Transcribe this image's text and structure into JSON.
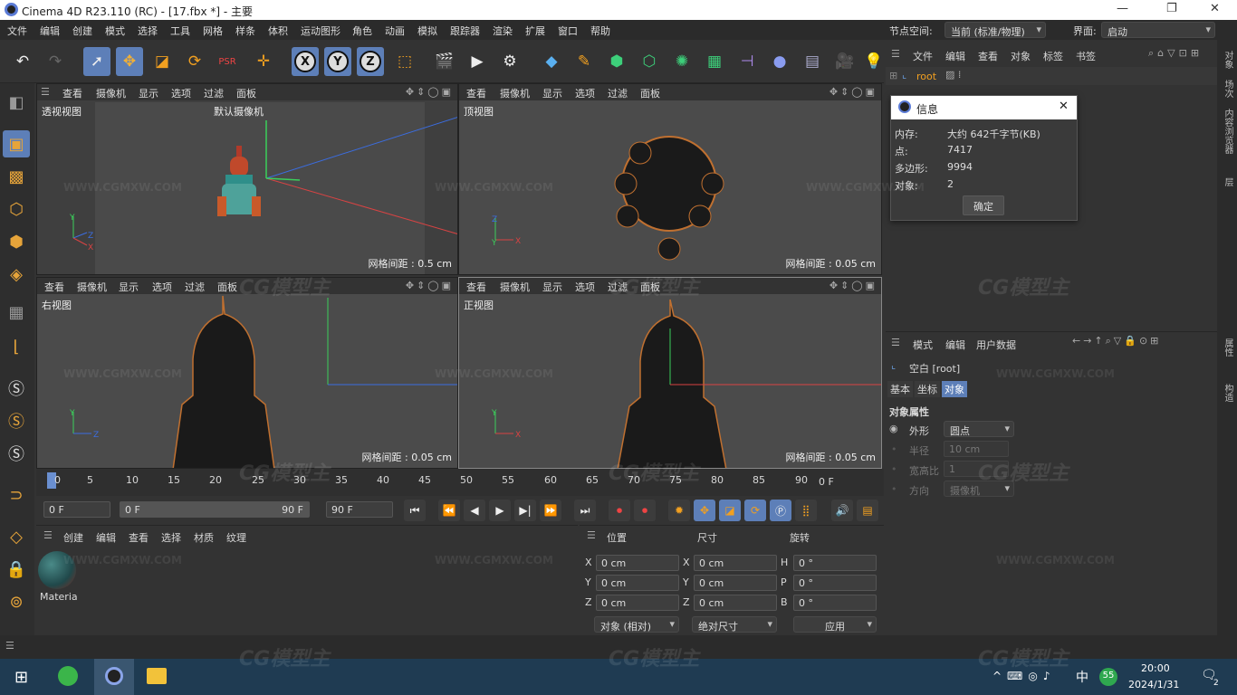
{
  "window": {
    "title": "Cinema 4D R23.110 (RC) - [17.fbx *] - 主要"
  },
  "menu": [
    "文件",
    "编辑",
    "创建",
    "模式",
    "选择",
    "工具",
    "网格",
    "样条",
    "体积",
    "运动图形",
    "角色",
    "动画",
    "模拟",
    "跟踪器",
    "渲染",
    "扩展",
    "窗口",
    "帮助"
  ],
  "node_space": {
    "label": "节点空间:",
    "value": "当前 (标准/物理)"
  },
  "layout": {
    "label": "界面:",
    "value": "启动"
  },
  "viewport_menu": [
    "查看",
    "摄像机",
    "显示",
    "选项",
    "过滤",
    "面板"
  ],
  "viewports": [
    {
      "name": "透视视图",
      "grid": "网格间距 : 0.5 cm",
      "camera": "默认摄像机"
    },
    {
      "name": "顶视图",
      "grid": "网格间距 : 0.05 cm"
    },
    {
      "name": "右视图",
      "grid": "网格间距 : 0.05 cm"
    },
    {
      "name": "正视图",
      "grid": "网格间距 : 0.05 cm"
    }
  ],
  "timeline": {
    "ticks": [
      "0",
      "5",
      "10",
      "15",
      "20",
      "25",
      "30",
      "35",
      "40",
      "45",
      "50",
      "55",
      "60",
      "65",
      "70",
      "75",
      "80",
      "85",
      "90"
    ],
    "current_frame_label": "0 F",
    "start": "0 F",
    "range_start": "0 F",
    "range_end": "90 F",
    "end": "90 F"
  },
  "material_menu": [
    "创建",
    "编辑",
    "查看",
    "选择",
    "材质",
    "纹理"
  ],
  "materials": [
    {
      "name": "Materia"
    }
  ],
  "coords": {
    "headers": [
      "位置",
      "尺寸",
      "旋转"
    ],
    "rows": [
      {
        "a": "X",
        "pos": "0 cm",
        "b": "X",
        "size": "0 cm",
        "c": "H",
        "rot": "0 °"
      },
      {
        "a": "Y",
        "pos": "0 cm",
        "b": "Y",
        "size": "0 cm",
        "c": "P",
        "rot": "0 °"
      },
      {
        "a": "Z",
        "pos": "0 cm",
        "b": "Z",
        "size": "0 cm",
        "c": "B",
        "rot": "0 °"
      }
    ],
    "mode": "对象 (相对)",
    "size_mode": "绝对尺寸",
    "apply": "应用"
  },
  "object_manager": {
    "menu": [
      "文件",
      "编辑",
      "查看",
      "对象",
      "标签",
      "书签"
    ],
    "root": "root"
  },
  "info_dialog": {
    "title": "信息",
    "rows": [
      {
        "label": "内存:",
        "value": "大约 642千字节(KB)"
      },
      {
        "label": "点:",
        "value": "7417"
      },
      {
        "label": "多边形:",
        "value": "9994"
      },
      {
        "label": "对象:",
        "value": "2"
      }
    ],
    "ok": "确定"
  },
  "attributes": {
    "menu": [
      "模式",
      "编辑",
      "用户数据"
    ],
    "object": "空白 [root]",
    "tabs": [
      "基本",
      "坐标",
      "对象"
    ],
    "active_tab": "对象",
    "section": "对象属性",
    "props": [
      {
        "label": "外形",
        "value": "圆点"
      },
      {
        "label": "半径",
        "value": "10 cm"
      },
      {
        "label": "宽高比",
        "value": "1"
      },
      {
        "label": "方向",
        "value": "摄像机"
      }
    ]
  },
  "right_strip": [
    "对象",
    "场次",
    "内容浏览器",
    "层",
    "属性",
    "构造"
  ],
  "taskbar": {
    "time": "20:00",
    "date": "2024/1/31",
    "ime": "中",
    "badge": "55",
    "notif": "2"
  },
  "watermark": {
    "url": "WWW.CGMXW.COM",
    "brand": "CG模型主"
  }
}
